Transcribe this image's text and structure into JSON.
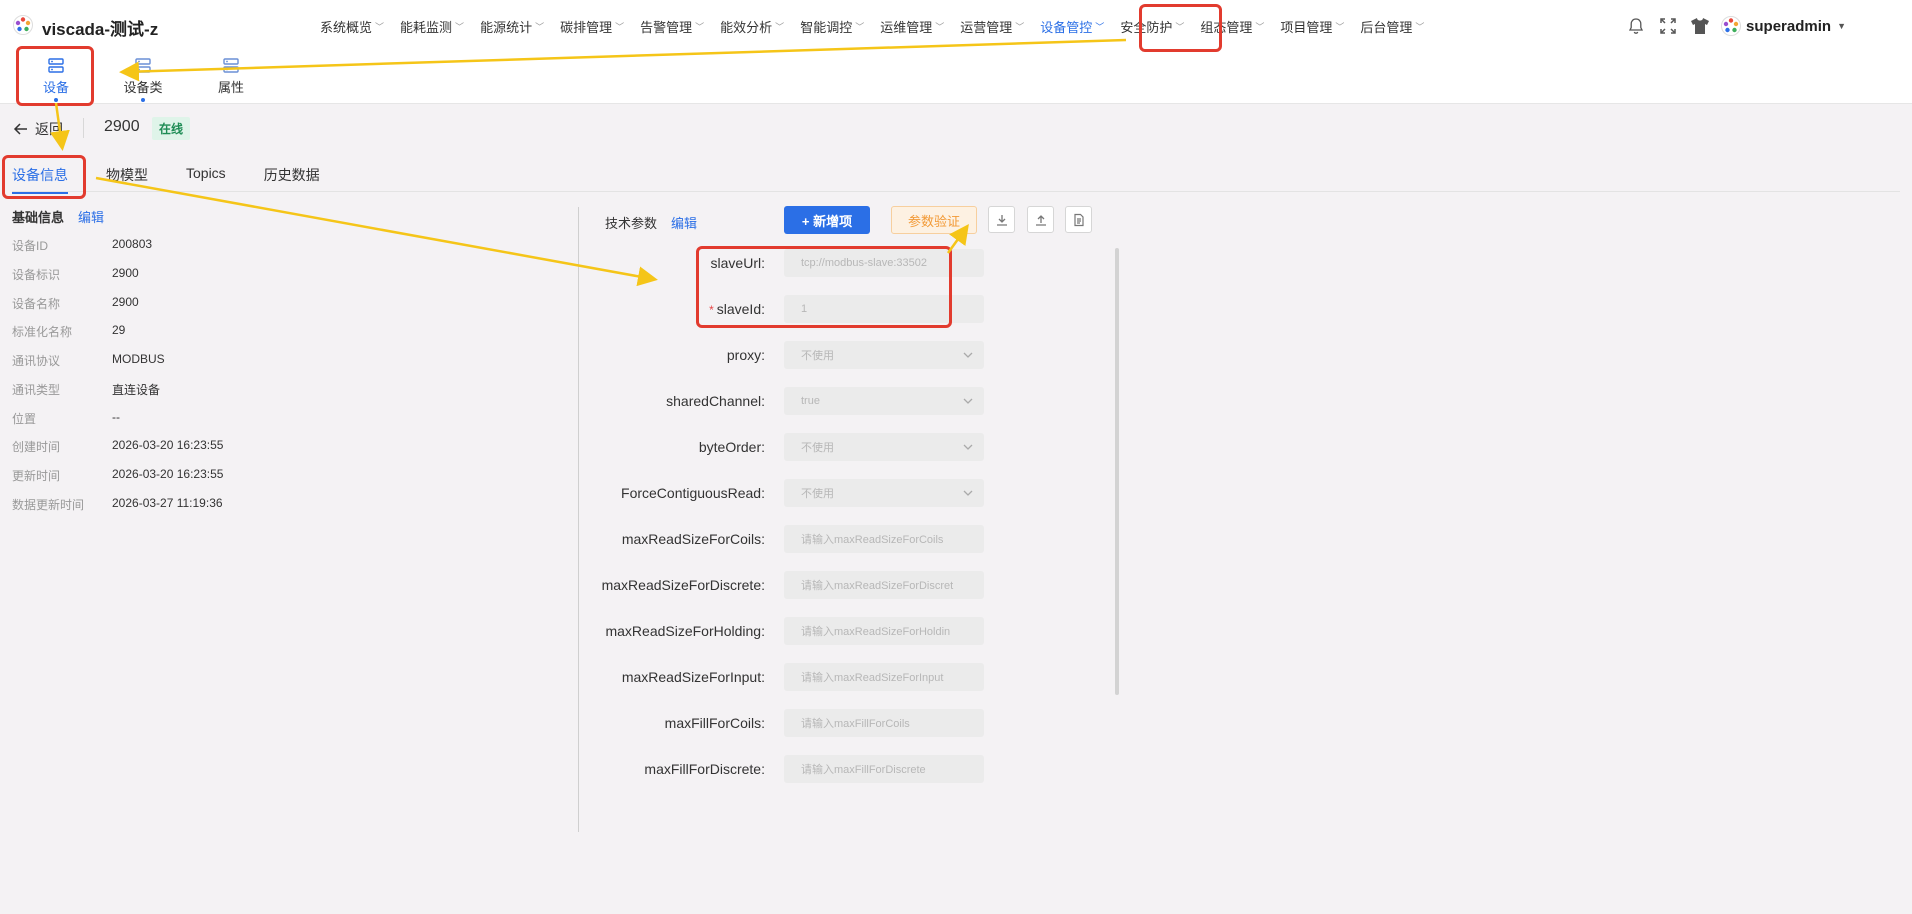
{
  "app": {
    "title": "viscada-测试-z",
    "user": "superadmin"
  },
  "nav": [
    {
      "label": "系统概览"
    },
    {
      "label": "能耗监测"
    },
    {
      "label": "能源统计"
    },
    {
      "label": "碳排管理"
    },
    {
      "label": "告警管理"
    },
    {
      "label": "能效分析"
    },
    {
      "label": "智能调控"
    },
    {
      "label": "运维管理"
    },
    {
      "label": "运营管理"
    },
    {
      "label": "设备管控",
      "active": true
    },
    {
      "label": "安全防护"
    },
    {
      "label": "组态管理"
    },
    {
      "label": "项目管理"
    },
    {
      "label": "后台管理"
    }
  ],
  "subnav": [
    {
      "label": "设备",
      "active": true
    },
    {
      "label": "设备类"
    },
    {
      "label": "属性"
    }
  ],
  "page": {
    "back_label": "返回",
    "device_title": "2900",
    "status": "在线"
  },
  "tabs": [
    {
      "label": "设备信息",
      "active": true
    },
    {
      "label": "物模型"
    },
    {
      "label": "Topics"
    },
    {
      "label": "历史数据"
    }
  ],
  "basic": {
    "title": "基础信息",
    "edit": "编辑",
    "rows": [
      {
        "k": "设备ID",
        "v": "200803"
      },
      {
        "k": "设备标识",
        "v": "2900"
      },
      {
        "k": "设备名称",
        "v": "2900"
      },
      {
        "k": "标准化名称",
        "v": "29"
      },
      {
        "k": "通讯协议",
        "v": "MODBUS"
      },
      {
        "k": "通讯类型",
        "v": "直连设备"
      },
      {
        "k": "位置",
        "v": "--"
      },
      {
        "k": "创建时间",
        "v": "2026-03-20 16:23:55"
      },
      {
        "k": "更新时间",
        "v": "2026-03-20 16:23:55"
      },
      {
        "k": "数据更新时间",
        "v": "2026-03-27 11:19:36"
      }
    ]
  },
  "tech": {
    "title": "技术参数",
    "edit": "编辑",
    "add_button": "+ 新增项",
    "verify_button": "参数验证",
    "params": [
      {
        "label": "slaveUrl:",
        "value": "tcp://modbus-slave:33502",
        "required": false,
        "select": false
      },
      {
        "label": "slaveId:",
        "value": "1",
        "required": true,
        "select": false
      },
      {
        "label": "proxy:",
        "value": "不使用",
        "required": false,
        "select": true
      },
      {
        "label": "sharedChannel:",
        "value": "true",
        "required": false,
        "select": true
      },
      {
        "label": "byteOrder:",
        "value": "不使用",
        "required": false,
        "select": true
      },
      {
        "label": "ForceContiguousRead:",
        "value": "不使用",
        "required": false,
        "select": true
      },
      {
        "label": "maxReadSizeForCoils:",
        "value": "请输入maxReadSizeForCoils",
        "required": false,
        "select": false
      },
      {
        "label": "maxReadSizeForDiscrete:",
        "value": "请输入maxReadSizeForDiscret",
        "required": false,
        "select": false
      },
      {
        "label": "maxReadSizeForHolding:",
        "value": "请输入maxReadSizeForHoldin",
        "required": false,
        "select": false
      },
      {
        "label": "maxReadSizeForInput:",
        "value": "请输入maxReadSizeForInput",
        "required": false,
        "select": false
      },
      {
        "label": "maxFillForCoils:",
        "value": "请输入maxFillForCoils",
        "required": false,
        "select": false
      },
      {
        "label": "maxFillForDiscrete:",
        "value": "请输入maxFillForDiscrete",
        "required": false,
        "select": false
      }
    ]
  },
  "colors": {
    "accent": "#2b6fe6",
    "annotation_red": "#e23b2e",
    "annotation_arrow": "#f5c518",
    "online": "#1f8c55"
  }
}
